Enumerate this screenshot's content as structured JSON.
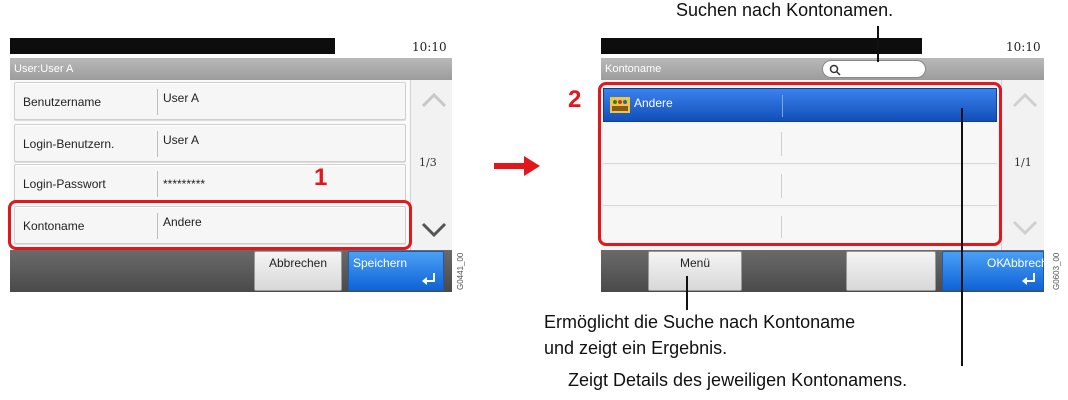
{
  "left_panel": {
    "clock": "10:10",
    "title": "User:User A",
    "rows": [
      {
        "label": "Benutzername",
        "value": "User A"
      },
      {
        "label": "Login-Benutzern.",
        "value": "User A"
      },
      {
        "label": "Login-Passwort",
        "value": "*********"
      },
      {
        "label": "Kontoname",
        "value": "Andere"
      }
    ],
    "page_indicator": "1/3",
    "cancel_label": "Abbrechen",
    "save_label": "Speichern",
    "image_id": "G0441_00",
    "marker": "1"
  },
  "right_panel": {
    "clock": "10:10",
    "title": "Kontoname",
    "search_placeholder": "",
    "list_items": [
      "Andere",
      "",
      "",
      ""
    ],
    "page_indicator": "1/1",
    "menu_label": "Menü",
    "ok_label": "OK",
    "cancel_label": "Abbreche",
    "image_id": "G0603_00",
    "marker": "2"
  },
  "callouts": {
    "top": "Suchen nach Kontonamen.",
    "menu": "Ermöglicht die Suche nach Kontoname und zeigt ein Ergebnis.",
    "menu_line1": "Ermöglicht die Suche nach Kontoname",
    "menu_line2": "und zeigt ein Ergebnis.",
    "details": "Zeigt Details des jeweiligen Kontonamens."
  },
  "colors": {
    "highlight_red": "#e3161b",
    "selected_blue": "#1a5fd0",
    "enter_blue": "#1063d6"
  }
}
